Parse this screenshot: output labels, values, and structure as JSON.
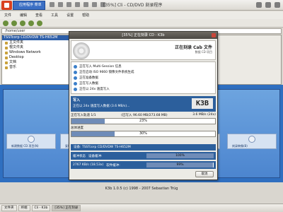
{
  "system": {
    "app_menu_label": "应用程序 菜单",
    "window_title": "[35%] Cli - CD/DVD 刻录程序"
  },
  "background": {
    "menus": [
      "文件",
      "编辑",
      "查看",
      "工具",
      "设置",
      "帮助"
    ],
    "url": "/home/user",
    "sidebar_header": "TSSTcorp CD/DVDW TS-H652M",
    "sidebar_items": [
      "主文件夹",
      "根文件夹",
      "Windows Network",
      "Desktop",
      "文档",
      "音乐"
    ],
    "actions": [
      "新建数据 CD 项目(N)",
      "复制 CD(C)",
      "新建音频 CD",
      "刻录映像(B)"
    ],
    "status_line": "K3b 1.0.5 (c) 1998 - 2007 Sebastian Trüg"
  },
  "dialog": {
    "title": "[35%] 正在刻录 CD - K3b",
    "header_title": "正在刻录 Cab 文件",
    "header_subtitle": "数据 CD 项目",
    "tasks": [
      "正在写入 Multi-Session 信息",
      "正在启动 ISO 9660 镜像文件系统生成",
      "正在准备数据",
      "正在写入数据",
      "正在以 24x 速度写入"
    ],
    "status_title": "写入",
    "status_message": "正在以 24x 速度写入数据 (3.6 MB/s)...",
    "logo_text": "K3B",
    "track_label": "正在写入轨道 1/1",
    "track_detail": "(已写入 96.60 MB/273.68 MB)",
    "track_speed": "3.6 MB/s (24x)",
    "track_percent": 23,
    "track_percent_text": "23%",
    "overall_label": "总体进度",
    "overall_percent": 30,
    "overall_percent_text": "30%",
    "device_label": "设备: TSSTcorp CD/DVDW TS-H652M",
    "buffer_label": "缓冲状态",
    "buffer_device": "设备缓冲:",
    "buffer_percent": 100,
    "buffer_percent_text": "100%",
    "fifo_label": "2767 KB/s (18.53x)",
    "fifo_device": "软件缓冲:",
    "fifo_percent": 99,
    "fifo_percent_text": "99%",
    "cancel_label": "取消"
  },
  "taskbar": {
    "items": [
      "文件夹",
      "终端",
      "Cli - K3b",
      "[35%] 正在刻录"
    ]
  }
}
